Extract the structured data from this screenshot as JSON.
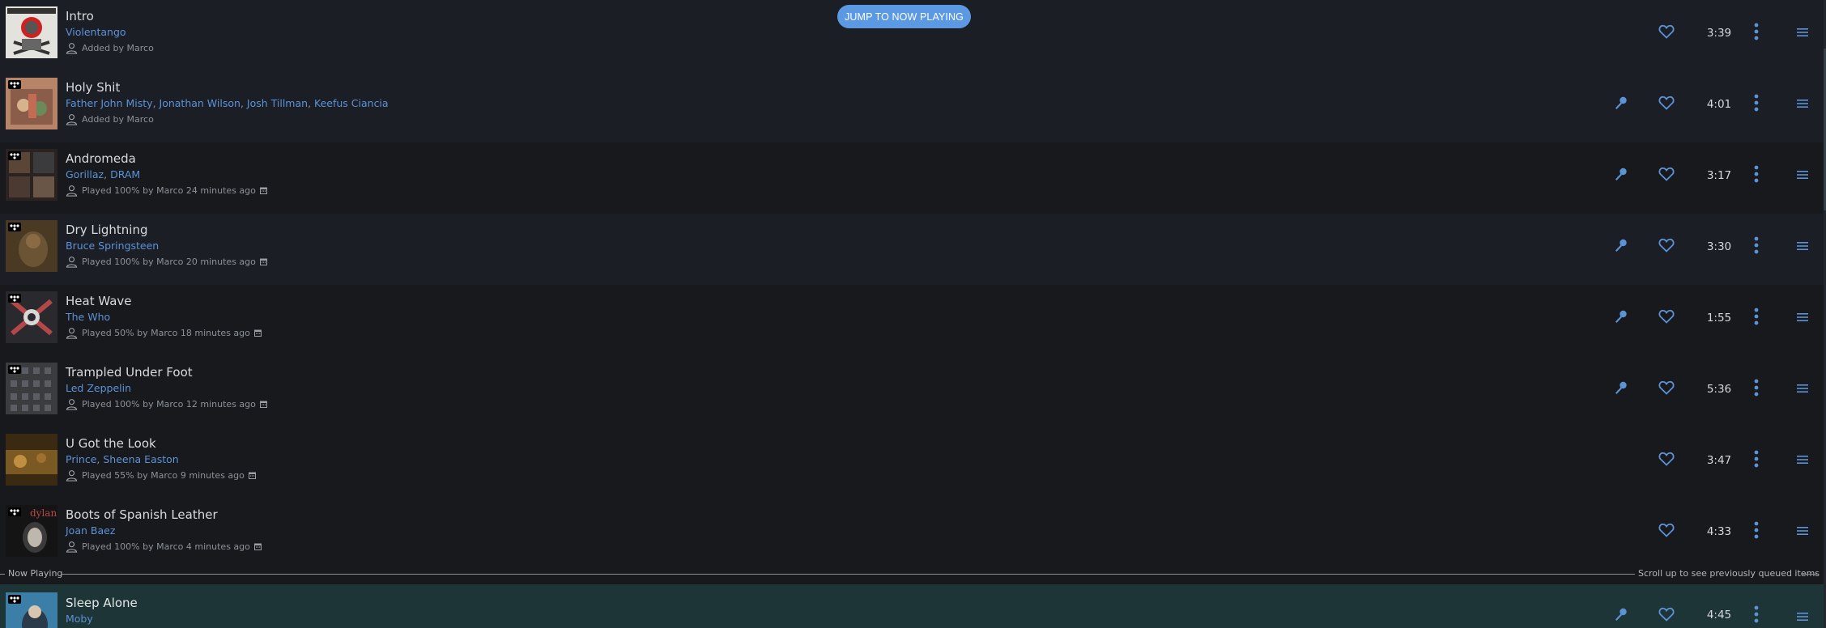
{
  "jump_button": "JUMP TO NOW PLAYING",
  "divider": {
    "left_label": "Now Playing",
    "right_label": "Scroll up to see previously queued items"
  },
  "colors": {
    "accent": "#5c92d6",
    "button": "#5b9ae2",
    "now_playing_bg": "#1e3538"
  },
  "tracks": [
    {
      "title": "Intro",
      "artists": [
        "Violentango"
      ],
      "meta": "Added by Marco",
      "duration": "3:39",
      "lyrics": false,
      "calendar": false,
      "cover": "violentango-cover"
    },
    {
      "title": "Holy Shit",
      "artists": [
        "Father John Misty",
        "Jonathan Wilson",
        "Josh Tillman",
        "Keefus Ciancia"
      ],
      "meta": "Added by Marco",
      "duration": "4:01",
      "lyrics": true,
      "calendar": false,
      "cover": "holy-shit-cover"
    },
    {
      "title": "Andromeda",
      "artists": [
        "Gorillaz",
        "DRAM"
      ],
      "meta": "Played 100% by Marco 24 minutes ago",
      "duration": "3:17",
      "lyrics": true,
      "calendar": true,
      "cover": "andromeda-cover"
    },
    {
      "title": "Dry Lightning",
      "artists": [
        "Bruce Springsteen"
      ],
      "meta": "Played 100% by Marco 20 minutes ago",
      "duration": "3:30",
      "lyrics": true,
      "calendar": true,
      "cover": "dry-lightning-cover"
    },
    {
      "title": "Heat Wave",
      "artists": [
        "The Who"
      ],
      "meta": "Played 50% by Marco 18 minutes ago",
      "duration": "1:55",
      "lyrics": true,
      "calendar": true,
      "cover": "heat-wave-cover"
    },
    {
      "title": "Trampled Under Foot",
      "artists": [
        "Led Zeppelin"
      ],
      "meta": "Played 100% by Marco 12 minutes ago",
      "duration": "5:36",
      "lyrics": true,
      "calendar": true,
      "cover": "trampled-cover"
    },
    {
      "title": "U Got the Look",
      "artists": [
        "Prince",
        "Sheena Easton"
      ],
      "meta": "Played 55% by Marco 9 minutes ago",
      "duration": "3:47",
      "lyrics": false,
      "calendar": true,
      "cover": "u-got-the-look-cover"
    },
    {
      "title": "Boots of Spanish Leather",
      "artists": [
        "Joan Baez"
      ],
      "meta": "Played 100% by Marco 4 minutes ago",
      "duration": "4:33",
      "lyrics": false,
      "calendar": true,
      "cover": "boots-cover"
    },
    {
      "title": "Sleep Alone",
      "artists": [
        "Moby"
      ],
      "meta": "",
      "duration": "4:45",
      "lyrics": true,
      "calendar": false,
      "cover": "sleep-alone-cover",
      "now_playing": true
    }
  ]
}
